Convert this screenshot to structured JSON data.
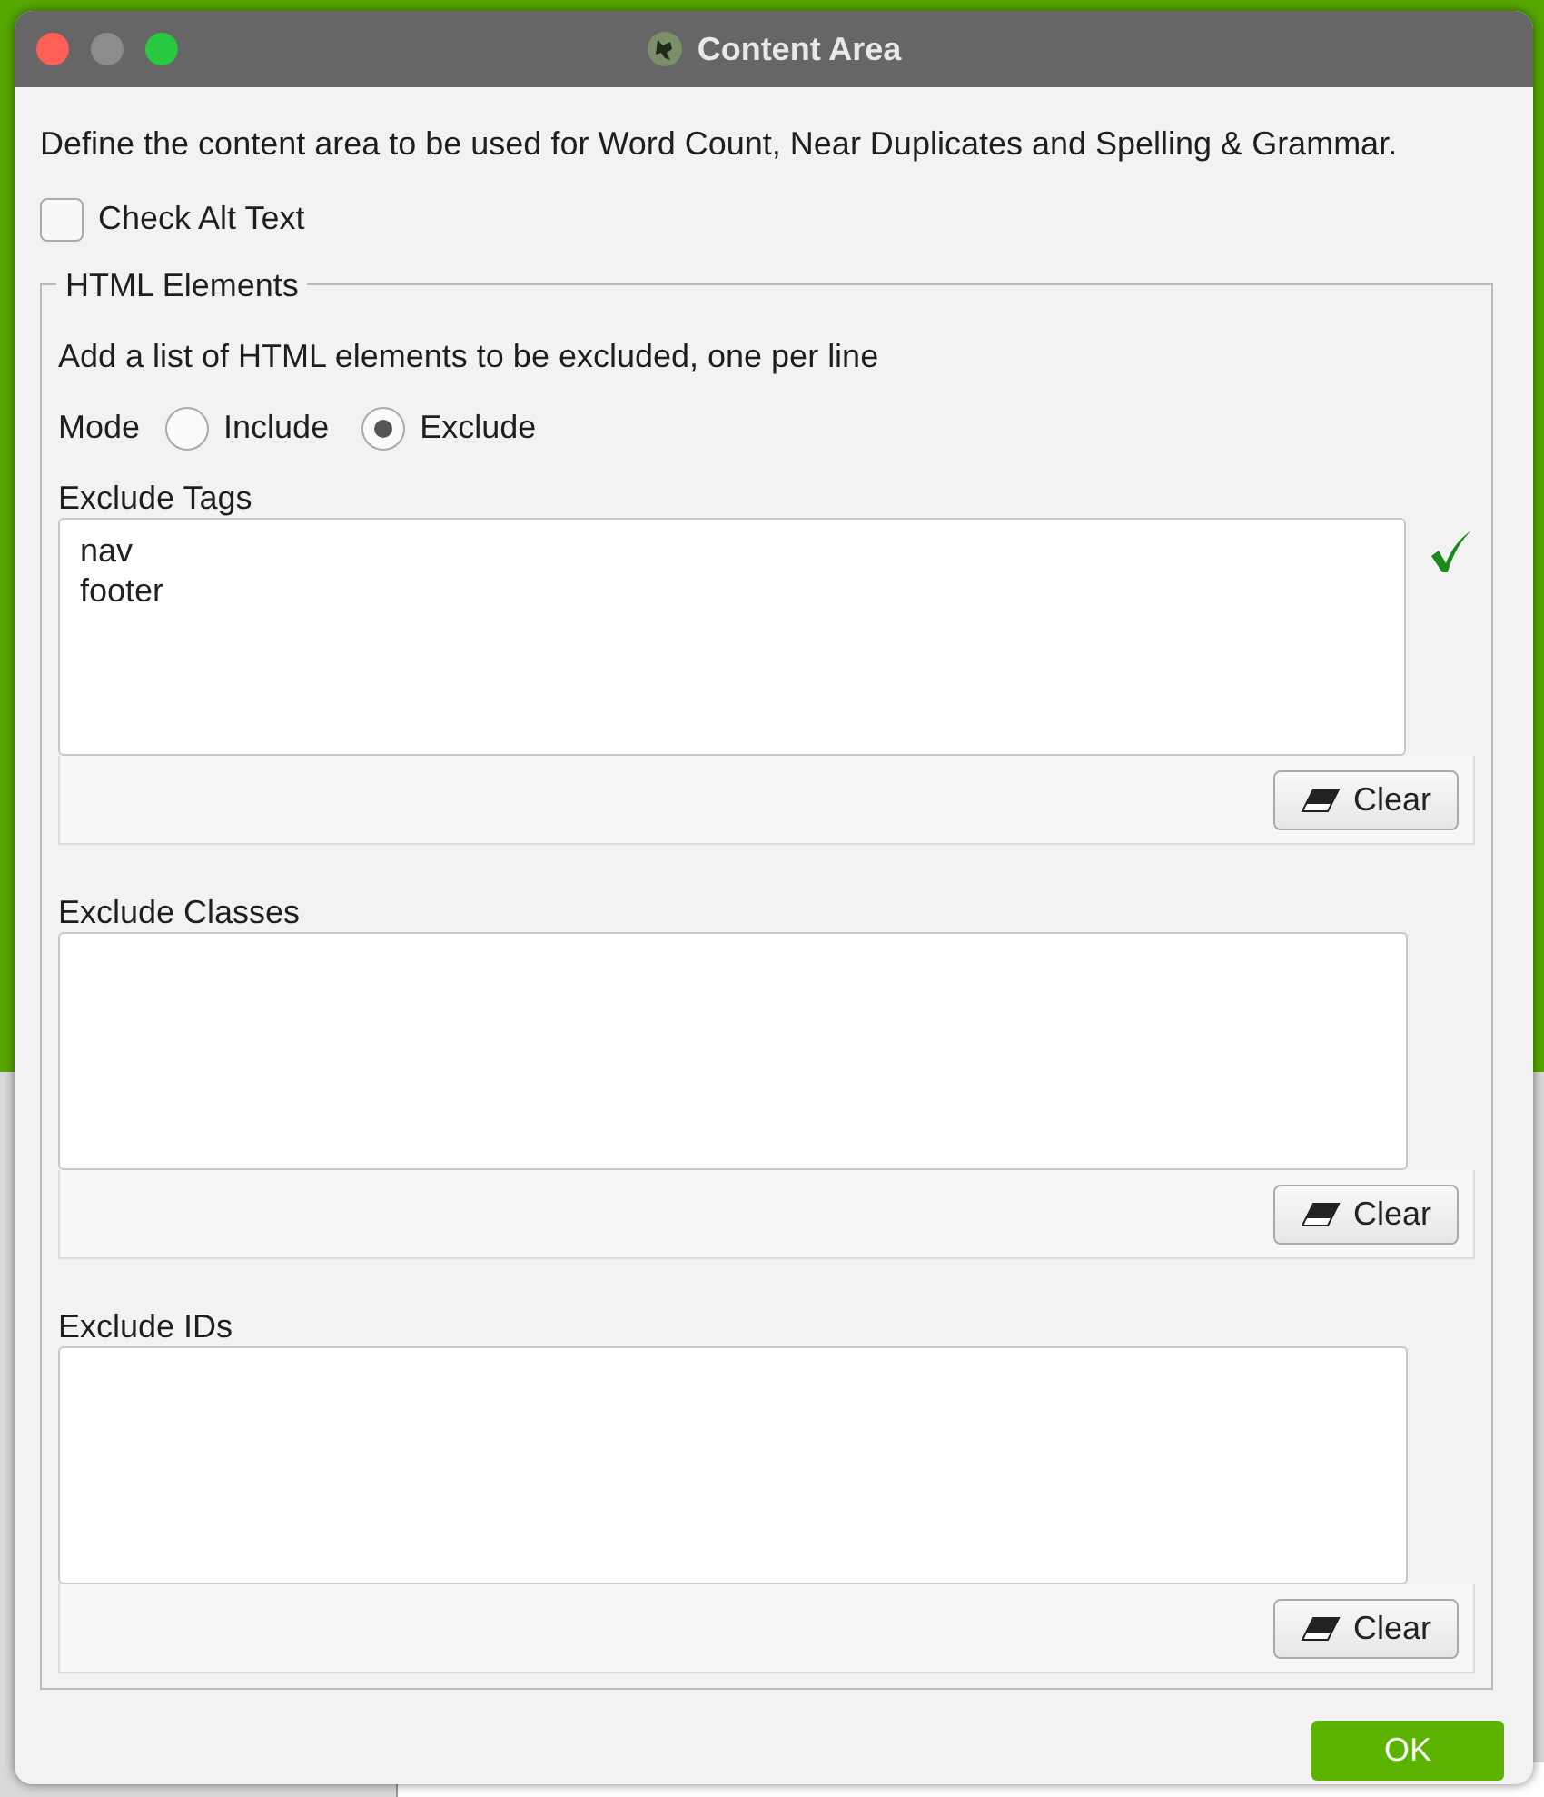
{
  "window": {
    "title": "Content Area"
  },
  "description": "Define the content area to be used for Word Count, Near Duplicates and Spelling & Grammar.",
  "check_alt_text": {
    "label": "Check Alt Text",
    "checked": false
  },
  "group": {
    "title": "HTML Elements",
    "hint": "Add a list of HTML elements to be excluded, one per line",
    "mode": {
      "label": "Mode",
      "options": [
        {
          "label": "Include",
          "selected": false
        },
        {
          "label": "Exclude",
          "selected": true
        }
      ]
    },
    "lists": [
      {
        "label": "Exclude Tags",
        "lines": [
          "nav",
          "footer"
        ],
        "valid": true,
        "clear_label": "Clear"
      },
      {
        "label": "Exclude Classes",
        "valid": false,
        "clear_label": "Clear"
      },
      {
        "label": "Exclude IDs",
        "valid": false,
        "clear_label": "Clear"
      }
    ]
  },
  "ok_button": "OK"
}
